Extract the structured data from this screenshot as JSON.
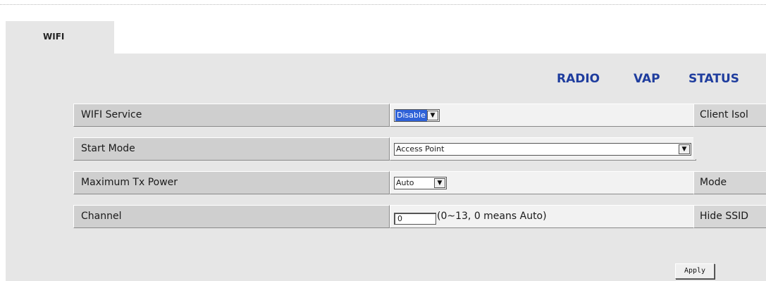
{
  "tab": {
    "label": "WIFI"
  },
  "nav": {
    "radio": "RADIO",
    "vap": "VAP",
    "status": "STATUS"
  },
  "rows": [
    {
      "label": "WIFI Service",
      "value": "Disable",
      "side": "Client Isol"
    },
    {
      "label": "Start Mode",
      "value": "Access Point",
      "side": ""
    },
    {
      "label": "Maximum Tx Power",
      "value": "Auto",
      "side": "Mode"
    },
    {
      "label": "Channel",
      "value": "0",
      "hint": "(0~13, 0 means Auto)",
      "side": "Hide SSID"
    }
  ],
  "apply_label": "Apply",
  "colors": {
    "panel": "#e6e6e6",
    "link": "#1f3d9e",
    "selected": "#2f62d8"
  }
}
